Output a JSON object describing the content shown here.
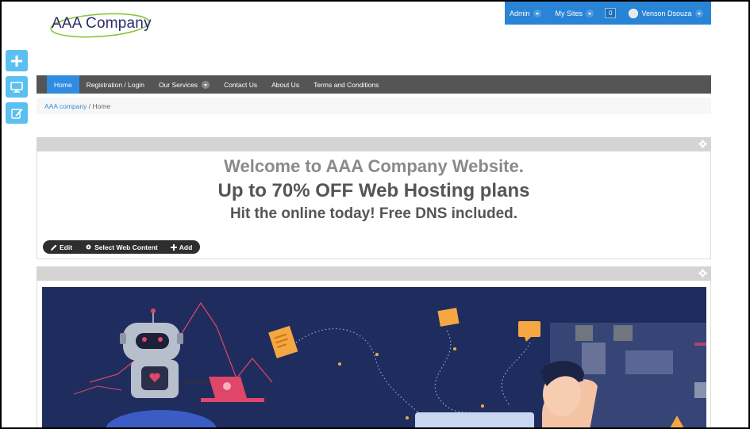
{
  "dockbar": {
    "admin": "Admin",
    "my_sites": "My Sites",
    "notification_count": "0",
    "user_name": "Venson Dsouza"
  },
  "logo": {
    "text": "AAA Company"
  },
  "sidebar": {
    "buttons": [
      {
        "icon": "plus-icon"
      },
      {
        "icon": "monitor-icon"
      },
      {
        "icon": "edit-icon"
      }
    ]
  },
  "nav": {
    "items": [
      {
        "label": "Home",
        "active": true
      },
      {
        "label": "Registration / Login"
      },
      {
        "label": "Our Services",
        "dropdown": true
      },
      {
        "label": "Contact Us"
      },
      {
        "label": "About Us"
      },
      {
        "label": "Terms and Conditions"
      }
    ]
  },
  "breadcrumb": {
    "root": "AAA company",
    "separator": "/",
    "current": "Home"
  },
  "content": {
    "welcome": "Welcome to AAA Company Website.",
    "offer": "Up to 70% OFF Web Hosting plans",
    "tagline": "Hit the online today! Free DNS included."
  },
  "edit_controls": {
    "edit": "Edit",
    "select_web_content": "Select Web Content",
    "add": "Add"
  },
  "colors": {
    "accent": "#2f8ce0",
    "dockbar": "#2a84d6",
    "side_buttons": "#5bc0f0",
    "nav_bg": "#555555",
    "banner_bg": "#1f2d5e"
  }
}
